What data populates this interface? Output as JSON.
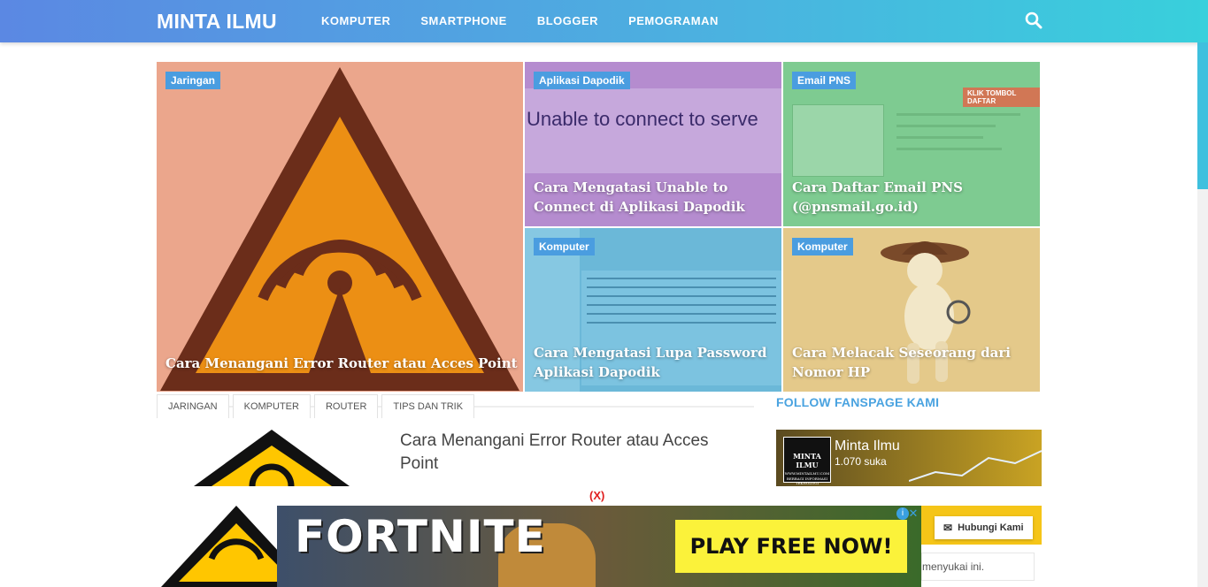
{
  "header": {
    "logo": "MINTA ILMU",
    "nav": [
      "KOMPUTER",
      "SMARTPHONE",
      "BLOGGER",
      "PEMOGRAMAN"
    ]
  },
  "featured": [
    {
      "category": "Jaringan",
      "title": "Cara Menangani Error Router atau Acces Point"
    },
    {
      "category": "Aplikasi Dapodik",
      "title": "Cara Mengatasi Unable to Connect di Aplikasi Dapodik",
      "image_text": "Unable to connect to serve"
    },
    {
      "category": "Email PNS",
      "title": "Cara Daftar Email PNS (@pnsmail.go.id)",
      "image_text": "KLIK TOMBOL DAFTAR"
    },
    {
      "category": "Komputer",
      "title": "Cara Mengatasi Lupa Password Aplikasi Dapodik"
    },
    {
      "category": "Komputer",
      "title": "Cara Melacak Seseorang dari Nomor HP"
    }
  ],
  "tags": [
    "JARINGAN",
    "KOMPUTER",
    "ROUTER",
    "TIPS DAN TRIK"
  ],
  "post": {
    "title": "Cara Menangani Error Router atau Acces Point"
  },
  "sidebar": {
    "follow_title": "FOLLOW FANSPAGE KAMI",
    "fb_name": "Minta Ilmu",
    "fb_likes": "1.070 suka",
    "fb_logo_text": "MINTA ILMU",
    "fb_logo_sub": "WWW.MINTAILMU.COM",
    "fb_logo_sub2": "BERBAGI INFORMASI TEKNOLOGI",
    "liked_text": "menyukai ini.",
    "contact_label": "Hubungi Kami"
  },
  "ad": {
    "close_label": "(X)",
    "title": "FORTNITE",
    "cta": "PLAY FREE NOW!"
  },
  "colors": {
    "accent": "#4a9de0",
    "header_start": "#5b88e3",
    "header_end": "#38d0dc"
  }
}
